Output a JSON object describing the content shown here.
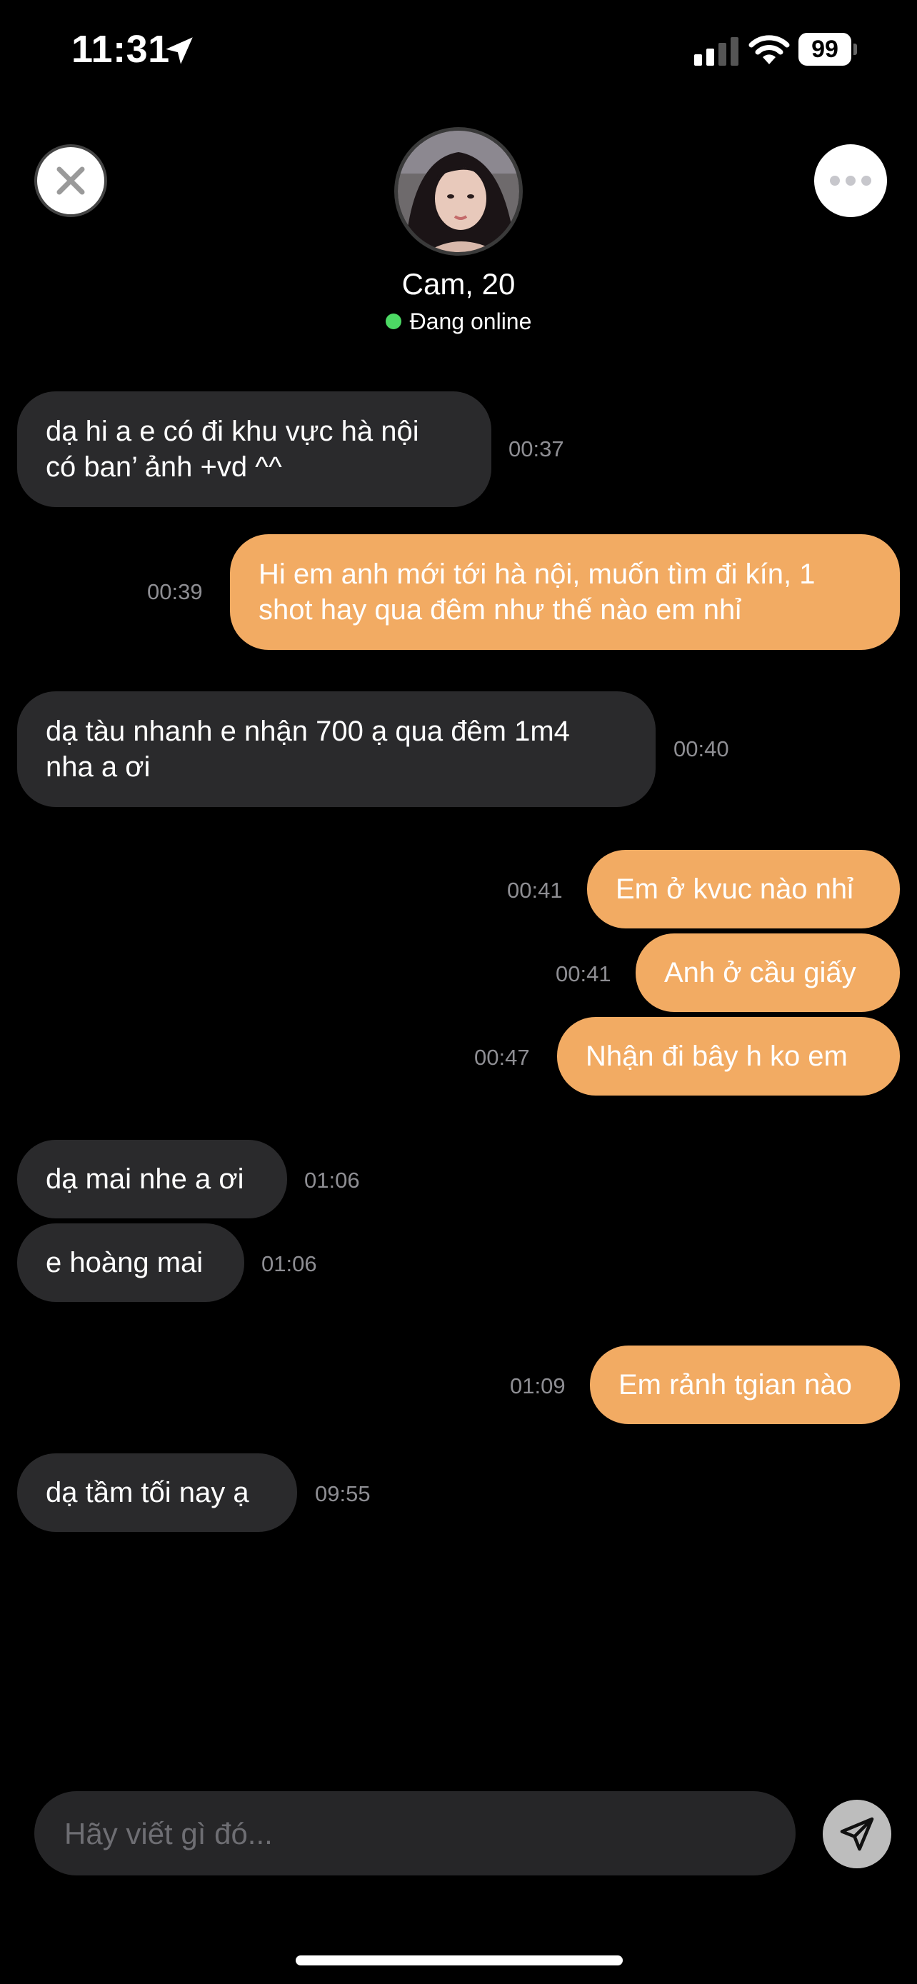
{
  "status_bar": {
    "time": "11:31",
    "battery": "99"
  },
  "profile": {
    "name": "Cam, 20",
    "status": "Đang online",
    "status_color": "#4cd964"
  },
  "messages": [
    {
      "from": "them",
      "lines": [
        "dạ hi a e có đi khu vực hà nội",
        "có ban’  ảnh +vd ^^"
      ],
      "time": "00:37"
    },
    {
      "from": "me",
      "lines": [
        "Hi em anh mới tới hà nội, muốn tìm đi kín, 1",
        "shot hay qua đêm như thế nào em nhỉ"
      ],
      "time": "00:39"
    },
    {
      "from": "them",
      "lines": [
        "dạ tàu nhanh e nhận 700 ạ qua đêm 1m4",
        "nha a ơi"
      ],
      "time": "00:40"
    },
    {
      "from": "me",
      "lines": [
        "Em ở kvuc nào nhỉ"
      ],
      "time": "00:41"
    },
    {
      "from": "me",
      "lines": [
        "Anh ở cầu giấy"
      ],
      "time": "00:41"
    },
    {
      "from": "me",
      "lines": [
        "Nhận đi bây h ko em"
      ],
      "time": "00:47"
    },
    {
      "from": "them",
      "lines": [
        "dạ mai nhe a ơi"
      ],
      "time": "01:06"
    },
    {
      "from": "them",
      "lines": [
        "e hoàng mai"
      ],
      "time": "01:06"
    },
    {
      "from": "me",
      "lines": [
        "Em rảnh tgian nào"
      ],
      "time": "01:09"
    },
    {
      "from": "them",
      "lines": [
        "dạ tầm tối nay ạ"
      ],
      "time": "09:55"
    }
  ],
  "composer": {
    "placeholder": "Hãy viết gì đó..."
  },
  "colors": {
    "outgoing_bubble": "#f2ab63",
    "incoming_bubble": "#2a2a2c",
    "background": "#000000"
  },
  "icons": [
    "location-arrow-icon",
    "signal-icon",
    "wifi-icon",
    "battery-icon",
    "close-icon",
    "more-icon",
    "send-icon"
  ]
}
